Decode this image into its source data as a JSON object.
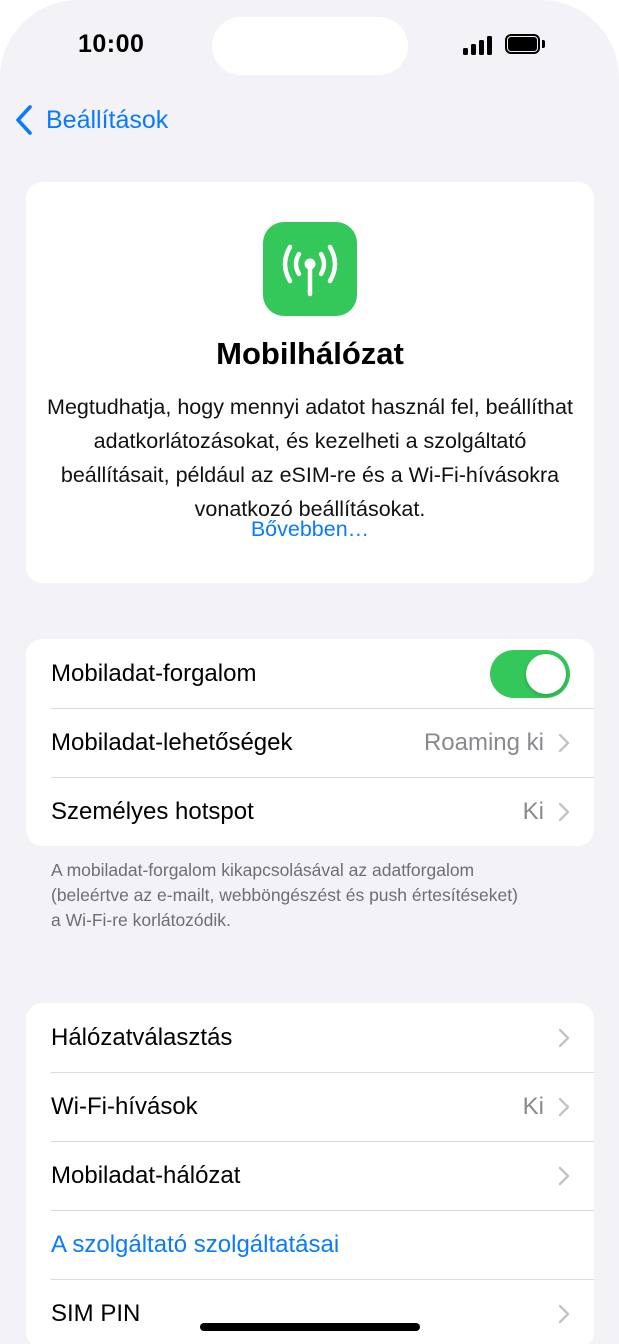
{
  "status_bar": {
    "time": "10:00"
  },
  "nav": {
    "back_label": "Beállítások"
  },
  "hero": {
    "icon": "antenna-radiowaves-icon",
    "icon_color": "#34c759",
    "title": "Mobilhálózat",
    "description": "Megtudhatja, hogy mennyi adatot használ fel, beállíthat adatkorlátozásokat, és kezelheti a szolgáltató beállításait, például az eSIM-re és a Wi-Fi-hívásokra vonatkozó beállításokat.",
    "link": "Bővebben…"
  },
  "group1": {
    "rows": [
      {
        "label": "Mobiladat-forgalom",
        "toggle_on": true
      },
      {
        "label": "Mobiladat-lehetőségek",
        "value": "Roaming ki"
      },
      {
        "label": "Személyes hotspot",
        "value": "Ki"
      }
    ],
    "footnote": "A mobiladat-forgalom kikapcsolásával az adatforgalom (beleértve az e-mailt, webböngészést és push értesítéseket) a Wi-Fi-re korlátozódik."
  },
  "group2": {
    "rows": [
      {
        "label": "Hálózatválasztás"
      },
      {
        "label": "Wi-Fi-hívások",
        "value": "Ki"
      },
      {
        "label": "Mobiladat-hálózat"
      },
      {
        "label": "A szolgáltató szolgáltatásai"
      },
      {
        "label": "SIM PIN"
      }
    ]
  },
  "colors": {
    "accent": "#0a7aff",
    "toggle_on": "#34c759",
    "background": "#f2f2f7"
  }
}
